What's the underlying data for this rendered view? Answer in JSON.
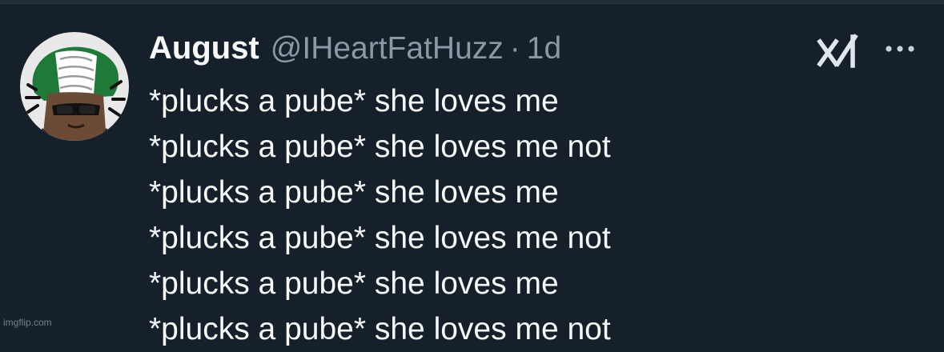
{
  "tweet": {
    "author_name": "August",
    "handle": "@IHeartFatHuzz",
    "separator": "·",
    "time": "1d",
    "lines": [
      "*plucks a pube* she loves me",
      "*plucks a pube* she loves me not",
      "*plucks a pube* she loves me",
      "*plucks a pube* she loves me not",
      "*plucks a pube* she loves me",
      "*plucks a pube* she loves me not"
    ]
  },
  "icons": {
    "avatar": "avatar-image",
    "grok": "grok-icon",
    "more": "more-icon"
  },
  "watermark": "imgflip.com",
  "colors": {
    "background": "#15202b",
    "text": "#f7f9f9",
    "secondary_text": "#8b98a5"
  }
}
